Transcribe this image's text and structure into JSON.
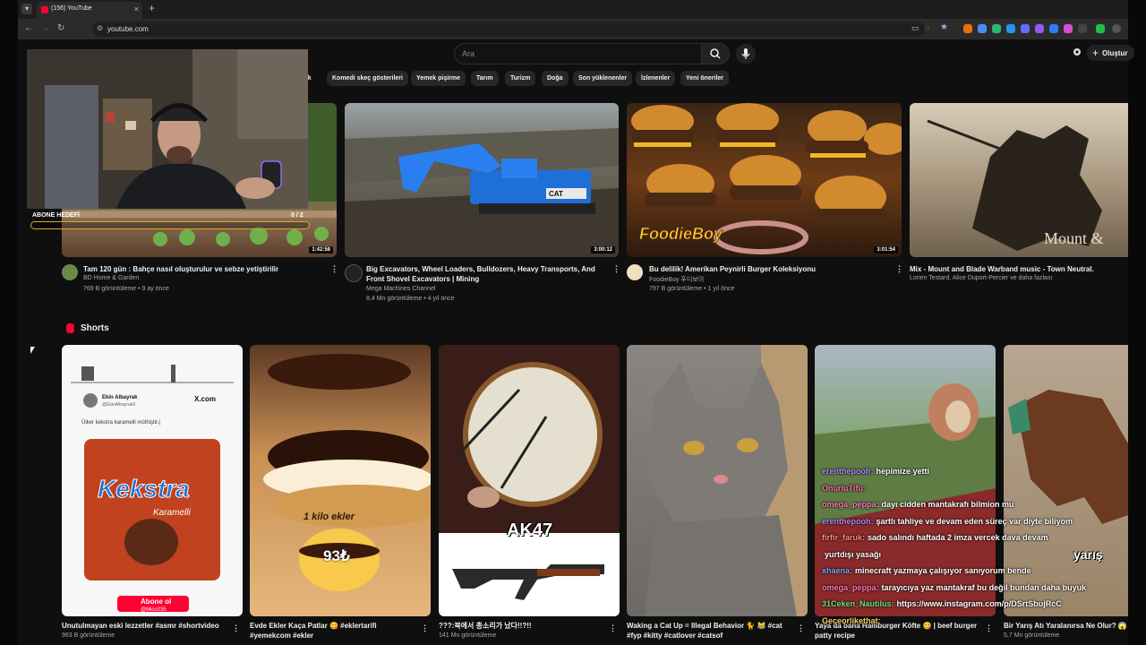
{
  "browser": {
    "tab_title": "(156) YouTube",
    "url": "youtube.com",
    "new_tab": "+",
    "tab_close": "×"
  },
  "header": {
    "search_placeholder": "Ara",
    "create_label": "Oluştur"
  },
  "chips": [
    "...lık",
    "Komedi skeç gösterileri",
    "Yemek pişirme",
    "Tarım",
    "Turizm",
    "Doğa",
    "Son yüklenenler",
    "İzlenenler",
    "Yeni öneriler"
  ],
  "videos": [
    {
      "title": "Tam 120 gün : Bahçe nasıl oluşturulur ve sebze yetiştirilir",
      "channel": "BD Home & Garden",
      "stats": "769 B görüntüleme • 9 ay önce",
      "duration": "1:42:58"
    },
    {
      "title": "Big Excavators, Wheel Loaders, Bulldozers, Heavy Transports, And Front Shovel Excavators | Mining",
      "channel": "Mega Machines Channel",
      "stats": "8,4 Mn görüntüleme • 4 yıl önce",
      "duration": "3:00:12",
      "thumb_text": "CAT"
    },
    {
      "title": "Bu delilik! Amerikan Peynirli Burger Koleksiyonu",
      "channel": "FoodieBoy 푸디보이",
      "stats": "797 B görüntüleme • 1 yıl önce",
      "duration": "3:01:54",
      "thumb_text": "FoodieBoy"
    },
    {
      "title": "Mix - Mount and Blade Warband music - Town Neutral.",
      "channel": "Lorien Testard, Alice Duport-Percier ve daha fazlası",
      "stats": "",
      "duration": "",
      "thumb_text": "Mount &"
    }
  ],
  "overlay": {
    "goal_label": "ABONE HEDEFİ",
    "goal_count": "0 / 2",
    "goal_progress": 0
  },
  "shorts": {
    "heading": "Shorts",
    "items": [
      {
        "title": "Unutulmayan eski lezzetler #asmr #shortvideo",
        "views": "963 B görüntüleme"
      },
      {
        "title": "Evde Ekler Kaça Patlar 😋 #eklertarifi #yemekcom #ekler",
        "views": ""
      },
      {
        "title": "???:북에서 총소리가 났다!!?!!",
        "views": "141 Mn görüntüleme"
      },
      {
        "title": "Waking a Cat Up = Illegal Behavior 🐈 😹 #cat #fyp #kitty #catlover #catsof",
        "views": ""
      },
      {
        "title": "Yaya da bana Hamburger Köfte 😋 | beef burger patty recipe",
        "views": ""
      },
      {
        "title": "Bir Yarış Atı Yaralanırsa Ne Olur? 😱",
        "views": "5,7 Mn görüntüleme"
      }
    ],
    "short1": {
      "user": "Ekin Albayrak",
      "handle": "@EkinAlbayrak9",
      "site": "X.com",
      "tweet": "Ülker kekstra karamelli müthiştir.(",
      "brand": "Kekstra",
      "flavor": "Karamelli",
      "sub": "Abone ol",
      "sub_handle": "@Mico235"
    },
    "short2": {
      "price_label": "1 kilo ekler",
      "price": "93₺"
    },
    "short3": {
      "label": "AK47"
    },
    "short6": {
      "label": "yarış"
    }
  },
  "chat": [
    {
      "user": "erenthepooh",
      "msg": "hepimize yetti",
      "color": "#b58bff"
    },
    {
      "user": "OnurluTifu",
      "msg": "",
      "color": "#ff6fa8"
    },
    {
      "user": "omega_peppa",
      "msg": "dayı cidden mantakrafı bilmion mu",
      "color": "#ff7ab6"
    },
    {
      "user": "erenthepooh",
      "msg": "şartlı tahliye ve devam eden süreç var diyte biliyom",
      "color": "#b58bff"
    },
    {
      "user": "firfir_faruk",
      "msg": "sado salındı haftada 2 imza vercek dava devam",
      "color": "#ff8c8c"
    },
    {
      "user": "",
      "msg": "yurtdışı yasağı",
      "color": "#ffffff"
    },
    {
      "user": "xhaena",
      "msg": "minecraft yazmaya çalışıyor sanıyorum bende",
      "color": "#7aa7ff"
    },
    {
      "user": "omega_peppa",
      "msg": "tarayıcıya yaz mantakraf bu değil bundan daha buyuk",
      "color": "#ff7ab6"
    },
    {
      "user": "31Ceken_Nautilus",
      "msg": "https://www.instagram.com/p/DSrtSbujRcC",
      "color": "#66e08a"
    },
    {
      "user": "Geceorlikethat",
      "msg": "",
      "color": "#ffd36a"
    }
  ],
  "colors": {
    "accent": "#ff0033",
    "goal": "#e0a32a",
    "chip_bg": "#272727"
  }
}
